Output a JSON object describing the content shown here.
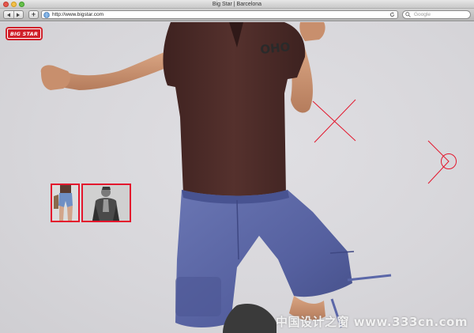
{
  "window": {
    "title": "Big Star | Barcelona"
  },
  "toolbar": {
    "add_label": "+",
    "url": "http://www.bigstar.com",
    "search_placeholder": "Google"
  },
  "page": {
    "logo_text": "BIG STAR",
    "watermark": "中国设计之窗 www.333cn.com",
    "shirt_print": "OHO"
  },
  "colors": {
    "accent_red": "#e3172d",
    "shirt_brown": "#4e2d2a",
    "shorts_blue": "#5b67a8"
  },
  "icons": {
    "back": "back-arrow-icon",
    "forward": "forward-arrow-icon",
    "site": "globe-icon",
    "reload": "reload-icon",
    "search": "magnifier-icon",
    "next": "circle-arrow-icon"
  }
}
